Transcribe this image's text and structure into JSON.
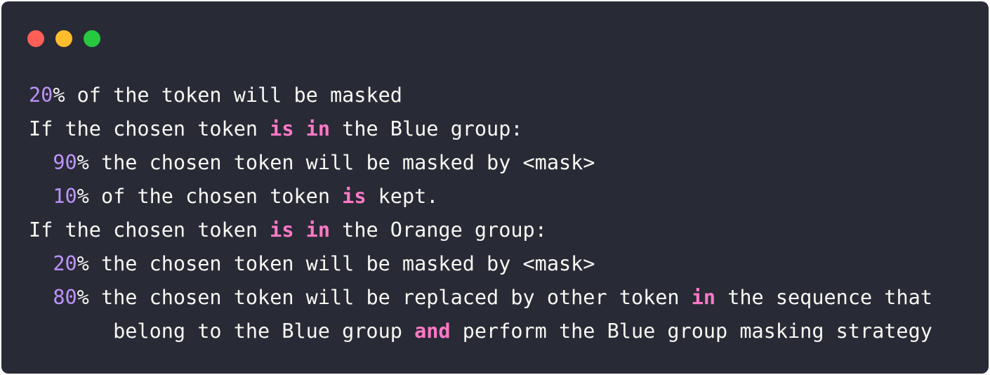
{
  "window": {
    "background": "#282a36",
    "controls": [
      {
        "name": "close",
        "color": "#ff5f56"
      },
      {
        "name": "minimize",
        "color": "#ffbd2e"
      },
      {
        "name": "maximize",
        "color": "#27c93f"
      }
    ]
  },
  "colors": {
    "number": "#bd93f9",
    "keyword": "#ff79c6",
    "text": "#f8f8f2"
  },
  "code": {
    "lines": [
      [
        {
          "t": "num",
          "v": "20"
        },
        {
          "t": "txt",
          "v": "% of the token will be masked"
        }
      ],
      [
        {
          "t": "txt",
          "v": "If the chosen token "
        },
        {
          "t": "kw",
          "v": "is"
        },
        {
          "t": "txt",
          "v": " "
        },
        {
          "t": "kw",
          "v": "in"
        },
        {
          "t": "txt",
          "v": " the Blue group:"
        }
      ],
      [
        {
          "t": "txt",
          "v": "  "
        },
        {
          "t": "num",
          "v": "90"
        },
        {
          "t": "txt",
          "v": "% the chosen token will be masked by <mask>"
        }
      ],
      [
        {
          "t": "txt",
          "v": "  "
        },
        {
          "t": "num",
          "v": "10"
        },
        {
          "t": "txt",
          "v": "% of the chosen token "
        },
        {
          "t": "kw",
          "v": "is"
        },
        {
          "t": "txt",
          "v": " kept."
        }
      ],
      [
        {
          "t": "txt",
          "v": "If the chosen token "
        },
        {
          "t": "kw",
          "v": "is"
        },
        {
          "t": "txt",
          "v": " "
        },
        {
          "t": "kw",
          "v": "in"
        },
        {
          "t": "txt",
          "v": " the Orange group:"
        }
      ],
      [
        {
          "t": "txt",
          "v": "  "
        },
        {
          "t": "num",
          "v": "20"
        },
        {
          "t": "txt",
          "v": "% the chosen token will be masked by <mask>"
        }
      ],
      [
        {
          "t": "txt",
          "v": "  "
        },
        {
          "t": "num",
          "v": "80"
        },
        {
          "t": "txt",
          "v": "% the chosen token will be replaced by other token "
        },
        {
          "t": "kw",
          "v": "in"
        },
        {
          "t": "txt",
          "v": " the sequence that"
        }
      ],
      [
        {
          "t": "txt",
          "v": "       belong to the Blue group "
        },
        {
          "t": "kw",
          "v": "and"
        },
        {
          "t": "txt",
          "v": " perform the Blue group masking strategy"
        }
      ]
    ]
  }
}
